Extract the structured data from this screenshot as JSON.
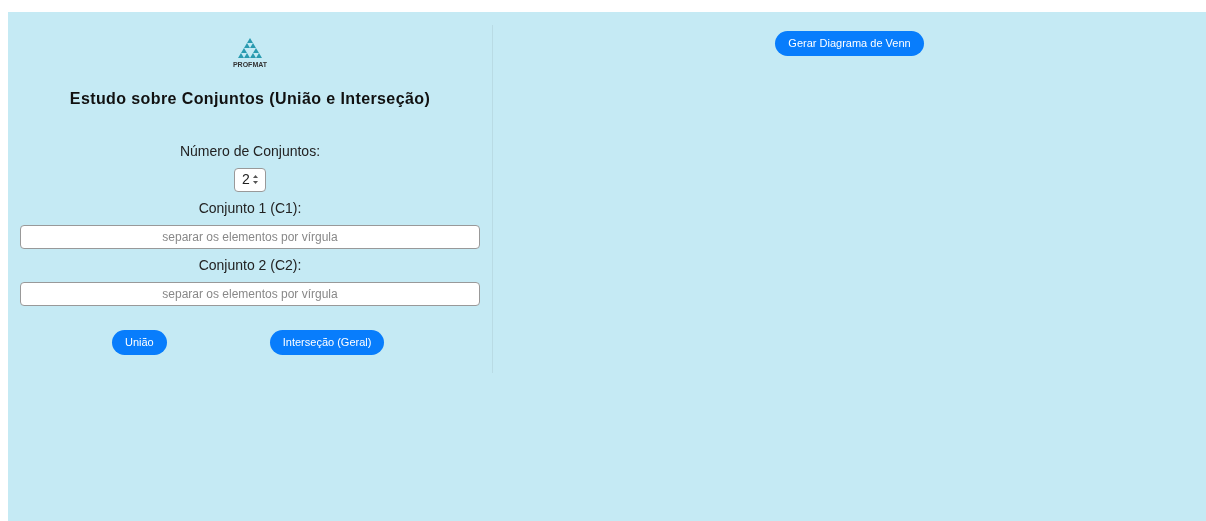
{
  "logo": {
    "text": "PROFMAT"
  },
  "title": "Estudo sobre Conjuntos (União e Interseção)",
  "count": {
    "label": "Número de Conjuntos:",
    "value": "2"
  },
  "sets": [
    {
      "label": "Conjunto 1 (C1):",
      "placeholder": "separar os elementos por vírgula"
    },
    {
      "label": "Conjunto 2 (C2):",
      "placeholder": "separar os elementos por vírgula"
    }
  ],
  "buttons": [
    "União",
    "Interseção (Geral)"
  ],
  "venn_button": "Gerar Diagrama de Venn"
}
